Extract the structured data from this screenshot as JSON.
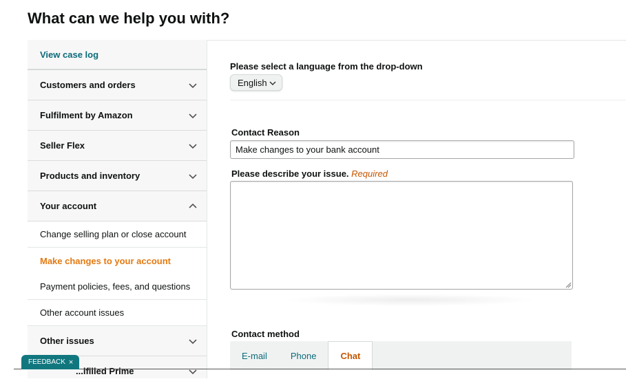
{
  "page_title": "What can we help you with?",
  "sidebar": {
    "case_log": "View case log",
    "items": [
      {
        "label": "Customers and orders",
        "chevron": "chevron-down-icon"
      },
      {
        "label": "Fulfilment by Amazon",
        "chevron": "chevron-down-icon"
      },
      {
        "label": "Seller Flex",
        "chevron": "chevron-down-icon"
      },
      {
        "label": "Products and inventory",
        "chevron": "chevron-down-icon"
      },
      {
        "label": "Your account",
        "chevron": "chevron-up-icon"
      }
    ],
    "sub_items": [
      "Change selling plan or close account",
      "Make changes to your account",
      "Payment policies, fees, and questions",
      "Other account issues"
    ],
    "after_items": [
      {
        "label": "Other issues",
        "chevron": "chevron-down-icon"
      },
      {
        "label": "...lfilled Prime",
        "chevron": "chevron-down-icon"
      }
    ]
  },
  "language": {
    "label": "Please select a language from the drop-down",
    "selected": "English"
  },
  "contact_reason": {
    "label": "Contact Reason",
    "value": "Make changes to your bank account"
  },
  "issue": {
    "label": "Please describe your issue.",
    "required": "Required",
    "value": ""
  },
  "contact_method": {
    "label": "Contact method",
    "tabs": [
      "E-mail",
      "Phone",
      "Chat"
    ],
    "active": "Chat"
  },
  "feedback": {
    "label": "FEEDBACK",
    "close": "×"
  },
  "colors": {
    "link": "#0b6b7a",
    "active_orange": "#e47911",
    "required": "#c45500",
    "feedback_bg": "#11777f"
  }
}
